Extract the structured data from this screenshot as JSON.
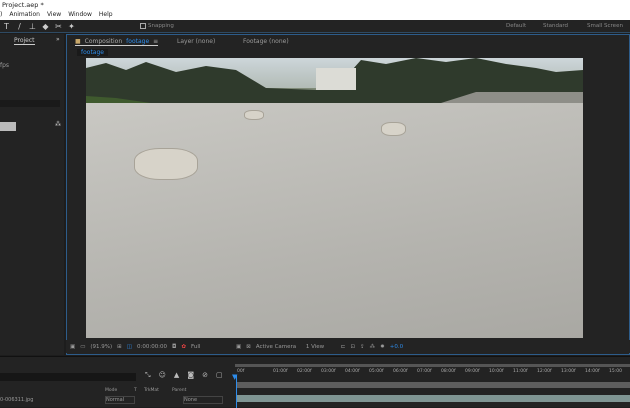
{
  "window": {
    "title": "Project.aep *"
  },
  "menu": [
    ")",
    "Animation",
    "View",
    "Window",
    "Help"
  ],
  "toolbar": {
    "tools": [
      "T",
      "/",
      "⊥",
      "◆",
      "✂",
      "✦"
    ],
    "snapping": "Snapping",
    "workspaces": [
      "Default",
      "Standard",
      "Small Screen"
    ]
  },
  "project_panel": {
    "tab": "Project",
    "info": "fps"
  },
  "comp_panel": {
    "tabs": [
      {
        "prefix": "Composition",
        "name": "footage"
      },
      {
        "label": "Layer (none)"
      },
      {
        "label": "Footage (none)"
      }
    ],
    "subtab": "footage"
  },
  "viewer_controls": {
    "zoom": "(91.9%)",
    "timecode": "0:00:00:00",
    "resolution": "Full",
    "camera": "Active Camera",
    "views": "1 View",
    "exposure": "+0.0"
  },
  "timeline": {
    "columns": [
      "Mode",
      "T",
      "TrkMat",
      "Parent"
    ],
    "layer": {
      "name": "0-006311.jpg",
      "mode": "Normal",
      "parent": "None"
    },
    "ticks": [
      "00f",
      "01:00f",
      "02:00f",
      "03:00f",
      "04:00f",
      "05:00f",
      "06:00f",
      "07:00f",
      "08:00f",
      "09:00f",
      "10:00f",
      "11:00f",
      "12:00f",
      "13:00f",
      "14:00f",
      "15:00"
    ]
  },
  "colors": {
    "accent": "#2d8ceb",
    "panel": "#232323"
  }
}
